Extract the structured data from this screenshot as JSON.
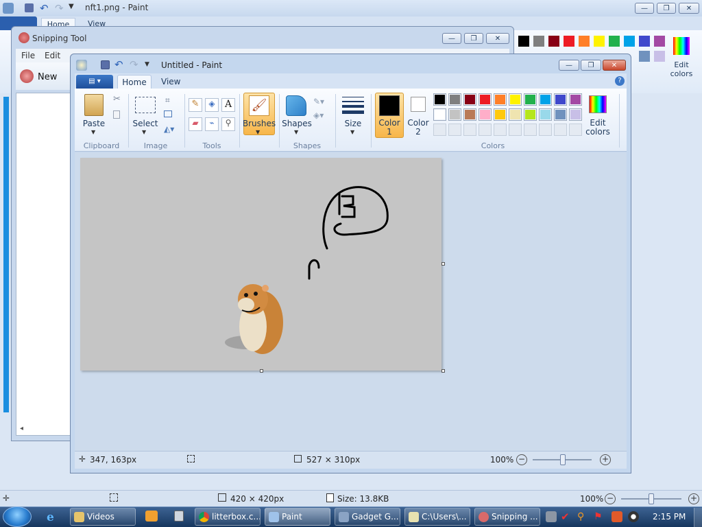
{
  "back_paint": {
    "title": "nft1.png - Paint",
    "tab_home": "Home",
    "tab_view": "View",
    "edit_colors": "Edit\ncolors",
    "status": {
      "size": "420 × 420px",
      "filesize": "Size: 13.8KB",
      "zoom": "100%"
    }
  },
  "snipping": {
    "title": "Snipping Tool",
    "menu": [
      "File",
      "Edit"
    ],
    "new_label": "New"
  },
  "paint": {
    "title": "Untitled - Paint",
    "tabs": [
      "Home",
      "View"
    ],
    "ribbon": {
      "paste": "Paste",
      "select": "Select",
      "brushes": "Brushes",
      "shapes": "Shapes",
      "size": "Size",
      "color1": "Color\n1",
      "color2": "Color\n2",
      "edit_colors": "Edit\ncolors",
      "groups": {
        "clipboard": "Clipboard",
        "image": "Image",
        "tools": "Tools",
        "shapes": "Shapes",
        "colors": "Colors"
      }
    },
    "palette": [
      "#000000",
      "#7f7f7f",
      "#880015",
      "#ed1c24",
      "#ff7f27",
      "#fff200",
      "#22b14c",
      "#00a2e8",
      "#3f48cc",
      "#a349a4",
      "#ffffff",
      "#c3c3c3",
      "#b97a57",
      "#ffaec9",
      "#ffc90e",
      "#efe4b0",
      "#b5e61d",
      "#99d9ea",
      "#7092be",
      "#c8bfe7"
    ],
    "color1": "#000000",
    "color2": "#ffffff",
    "status": {
      "cursor": "347, 163px",
      "selection": "527 × 310px",
      "zoom": "100%"
    }
  },
  "taskbar": {
    "items": [
      "Videos",
      "litterbox.c...",
      "Paint",
      "Gadget G...",
      "C:\\Users\\...",
      "Snipping ..."
    ],
    "clock": "2:15 PM"
  },
  "colors": {
    "accent": "#1e395b",
    "ribbon_tab": "#2b5fae",
    "brush_active": "#f7b64a",
    "taskbar": "#16365e"
  }
}
